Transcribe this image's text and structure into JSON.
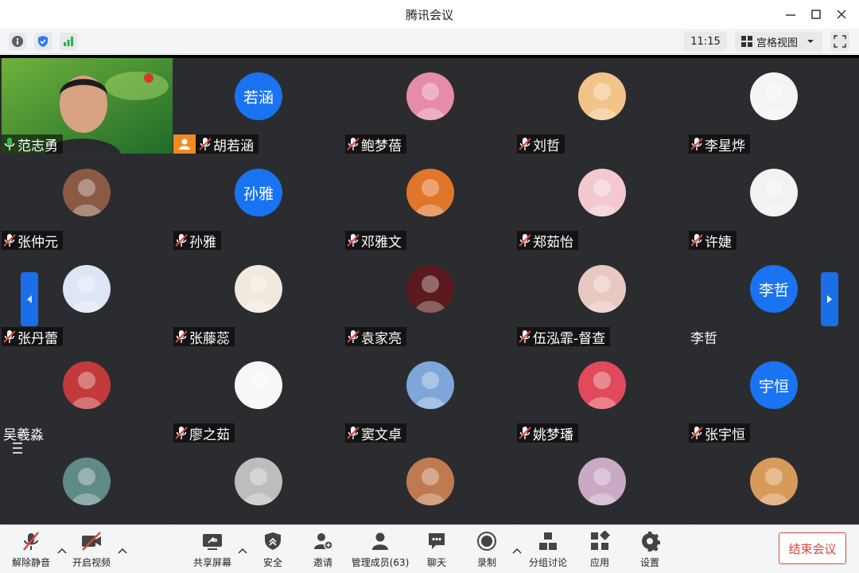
{
  "window": {
    "title": "腾讯会议"
  },
  "subbar": {
    "time": "11:15",
    "view_label": "宫格视图"
  },
  "participants": [
    {
      "name": "范志勇",
      "type": "video",
      "mic": "on"
    },
    {
      "name": "胡若涵",
      "type": "text",
      "avatar_text": "若涵",
      "mic": "muted",
      "host_badge": true
    },
    {
      "name": "鲍梦蓓",
      "type": "image",
      "color": "#e58ca8",
      "mic": "muted"
    },
    {
      "name": "刘哲",
      "type": "image",
      "color": "#f2c48a",
      "mic": "muted"
    },
    {
      "name": "李星烨",
      "type": "image",
      "color": "#f4f4f4",
      "mic": "muted"
    },
    {
      "name": "张仲元",
      "type": "image",
      "color": "#8a5a45",
      "mic": "muted"
    },
    {
      "name": "孙雅",
      "type": "text",
      "avatar_text": "孙雅",
      "mic": "muted"
    },
    {
      "name": "邓雅文",
      "type": "image",
      "color": "#e0762a",
      "mic": "muted"
    },
    {
      "name": "郑茹怡",
      "type": "image",
      "color": "#f3c9cf",
      "mic": "muted"
    },
    {
      "name": "许婕",
      "type": "image",
      "color": "#f2f2f2",
      "mic": "muted"
    },
    {
      "name": "张丹蕾",
      "type": "image",
      "color": "#dde6f4",
      "mic": "muted"
    },
    {
      "name": "张藤蕊",
      "type": "image",
      "color": "#f1e8de",
      "mic": "muted"
    },
    {
      "name": "袁家亮",
      "type": "image",
      "color": "#5a1a1e",
      "mic": "muted"
    },
    {
      "name": "伍泓霏-督查",
      "type": "image",
      "color": "#e9c8c2",
      "mic": "muted"
    },
    {
      "name": "李哲",
      "type": "text",
      "avatar_text": "李哲",
      "mic": "none"
    },
    {
      "name": "吴羲淼",
      "type": "image",
      "color": "#c23a3a",
      "mic": "none"
    },
    {
      "name": "廖之茹",
      "type": "image",
      "color": "#f7f7f7",
      "mic": "muted"
    },
    {
      "name": "窦文卓",
      "type": "image",
      "color": "#7fa6d8",
      "mic": "muted"
    },
    {
      "name": "姚梦璠",
      "type": "image",
      "color": "#e04a5a",
      "mic": "muted"
    },
    {
      "name": "张宇恒",
      "type": "text",
      "avatar_text": "宇恒",
      "mic": "muted"
    },
    {
      "name": "",
      "type": "image",
      "color": "#5f8a86",
      "mic": "none"
    },
    {
      "name": "",
      "type": "image",
      "color": "#bdbdbd",
      "mic": "none"
    },
    {
      "name": "",
      "type": "image",
      "color": "#c07a50",
      "mic": "none"
    },
    {
      "name": "",
      "type": "image",
      "color": "#caa9c4",
      "mic": "none"
    },
    {
      "name": "",
      "type": "image",
      "color": "#d89a5a",
      "mic": "none"
    }
  ],
  "toolbar": {
    "mute": "解除静音",
    "video": "开启视频",
    "share": "共享屏幕",
    "security": "安全",
    "invite": "邀请",
    "members": "管理成员(63)",
    "chat": "聊天",
    "record": "录制",
    "breakout": "分组讨论",
    "apps": "应用",
    "settings": "设置",
    "end": "结束会议"
  },
  "colors": {
    "accent": "#1a73f0",
    "end_red": "#e0443b",
    "grid_bg": "#2a2b2e"
  }
}
